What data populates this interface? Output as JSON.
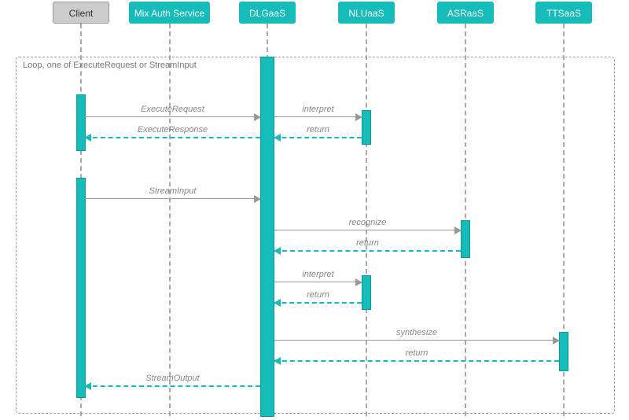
{
  "chart_data": {
    "type": "sequence-diagram",
    "title": "Loop, one of ExecuteRequest or StreamInput",
    "participants": [
      {
        "id": "client",
        "label": "Client",
        "kind": "actor"
      },
      {
        "id": "mixauth",
        "label": "Mix Auth Service",
        "kind": "service"
      },
      {
        "id": "dlgaas",
        "label": "DLGaaS",
        "kind": "service"
      },
      {
        "id": "nluaas",
        "label": "NLUaaS",
        "kind": "service"
      },
      {
        "id": "asraas",
        "label": "ASRaaS",
        "kind": "service"
      },
      {
        "id": "ttsaas",
        "label": "TTSaaS",
        "kind": "service"
      }
    ],
    "loop": {
      "label": "Loop, one of ExecuteRequest or StreamInput",
      "branches": [
        {
          "name": "ExecuteRequest",
          "messages": [
            {
              "from": "client",
              "to": "dlgaas",
              "label": "ExecuteRequest",
              "return": false
            },
            {
              "from": "dlgaas",
              "to": "nluaas",
              "label": "interpret",
              "return": false
            },
            {
              "from": "nluaas",
              "to": "dlgaas",
              "label": "return",
              "return": true
            },
            {
              "from": "dlgaas",
              "to": "client",
              "label": "ExecuteResponse",
              "return": true
            }
          ]
        },
        {
          "name": "StreamInput",
          "messages": [
            {
              "from": "client",
              "to": "dlgaas",
              "label": "StreamInput",
              "return": false
            },
            {
              "from": "dlgaas",
              "to": "asraas",
              "label": "recognize",
              "return": false
            },
            {
              "from": "asraas",
              "to": "dlgaas",
              "label": "return",
              "return": true
            },
            {
              "from": "dlgaas",
              "to": "nluaas",
              "label": "interpret",
              "return": false
            },
            {
              "from": "nluaas",
              "to": "dlgaas",
              "label": "return",
              "return": true
            },
            {
              "from": "dlgaas",
              "to": "ttsaas",
              "label": "synthesize",
              "return": false
            },
            {
              "from": "ttsaas",
              "to": "dlgaas",
              "label": "return",
              "return": true
            },
            {
              "from": "dlgaas",
              "to": "client",
              "label": "StreamOutput",
              "return": true
            }
          ]
        }
      ]
    }
  },
  "participants": {
    "client": "Client",
    "mixauth": "Mix Auth Service",
    "dlgaas": "DLGaaS",
    "nluaas": "NLUaaS",
    "asraas": "ASRaaS",
    "ttsaas": "TTSaaS"
  },
  "loop_label": "Loop, one of ExecuteRequest or StreamInput",
  "messages": {
    "m1": "ExecuteRequest",
    "m2": "interpret",
    "m3": "return",
    "m4": "ExecuteResponse",
    "m5": "StreamInput",
    "m6": "recognize",
    "m7": "return",
    "m8": "interpret",
    "m9": "return",
    "m10": "synthesize",
    "m11": "return",
    "m12": "StreamOutput"
  }
}
